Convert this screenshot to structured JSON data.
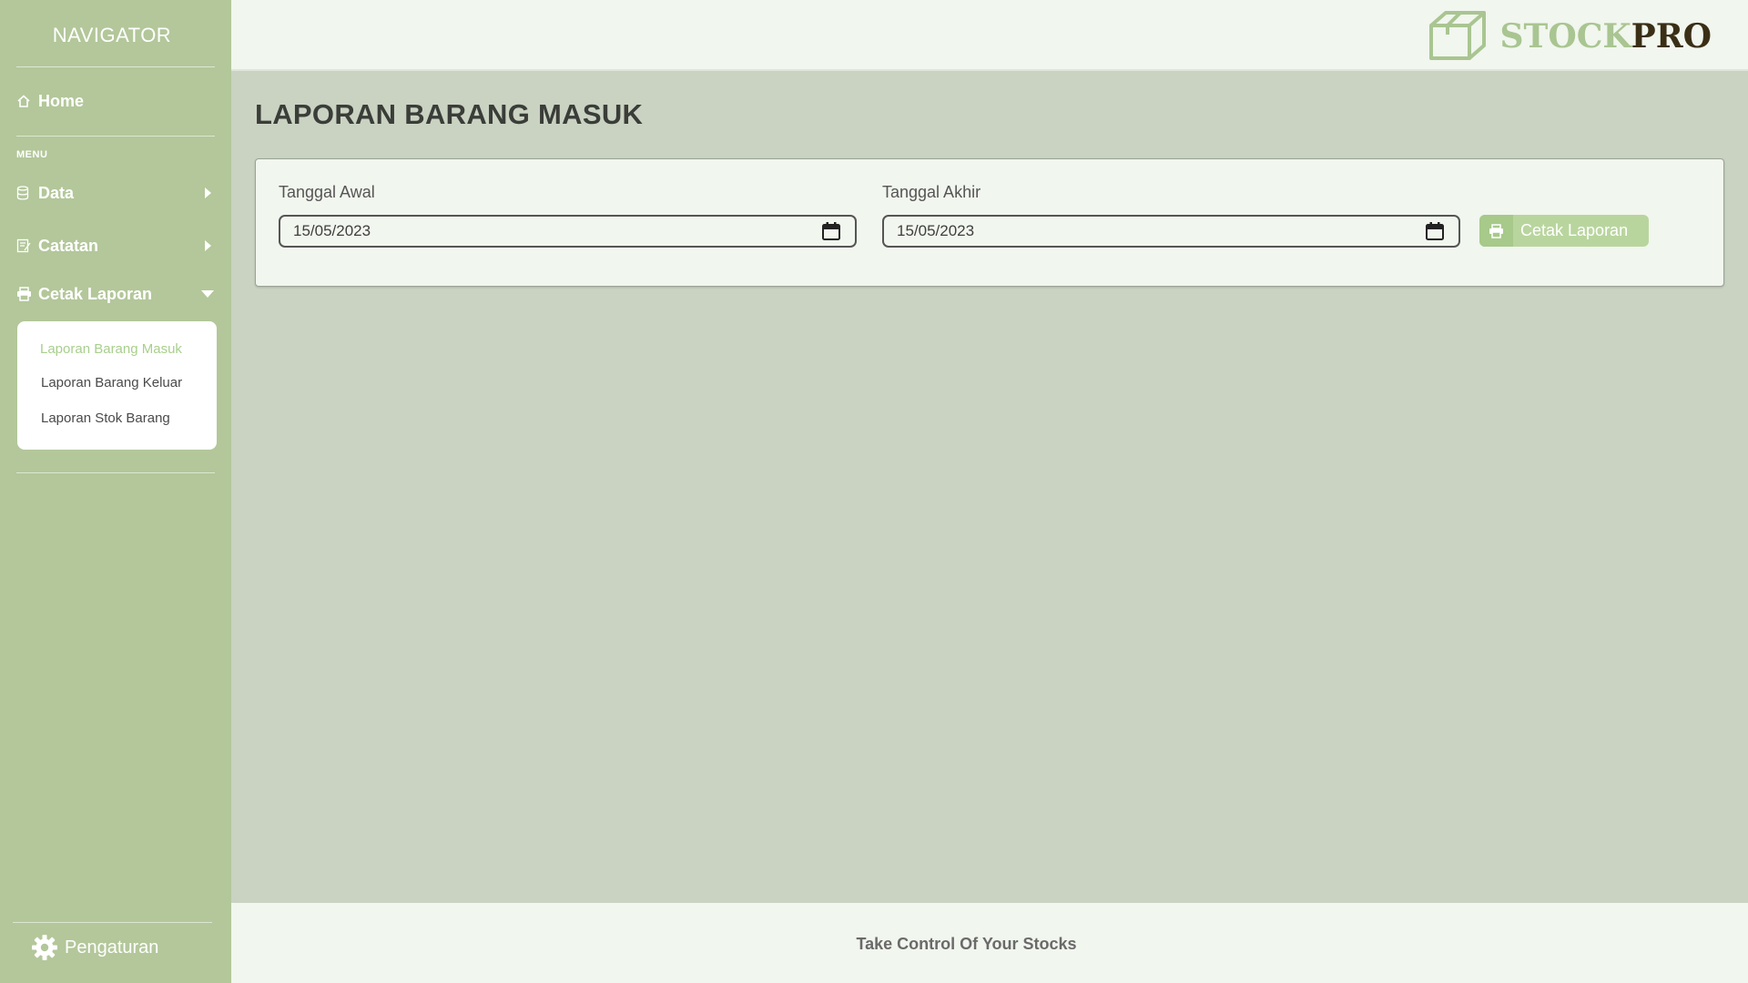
{
  "sidebar": {
    "title": "NAVIGATOR",
    "home_label": "Home",
    "menu_caption": "MENU",
    "items": [
      {
        "label": "Data",
        "icon": "database-icon"
      },
      {
        "label": "Catatan",
        "icon": "notes-icon"
      },
      {
        "label": "Cetak Laporan",
        "icon": "printer-icon"
      }
    ],
    "submenu": [
      {
        "label": "Laporan Barang Masuk",
        "active": true
      },
      {
        "label": "Laporan Barang Keluar",
        "active": false
      },
      {
        "label": "Laporan Stok Barang",
        "active": false
      }
    ],
    "settings_label": "Pengaturan"
  },
  "header": {
    "logo_part1": "STOCK",
    "logo_part2": "PRO"
  },
  "main": {
    "title": "LAPORAN BARANG MASUK",
    "start_label": "Tanggal Awal",
    "start_value": "15/05/2023",
    "end_label": "Tanggal Akhir",
    "end_value": "15/05/2023",
    "print_button": "Cetak Laporan"
  },
  "footer": {
    "tagline": "Take Control Of Your Stocks"
  },
  "colors": {
    "sidebar": "#b3c79a",
    "content_bg": "#cad3c2",
    "panel": "#f1f6ee",
    "accent_light": "#a8cf8c",
    "logo_dark": "#3a2f16"
  }
}
